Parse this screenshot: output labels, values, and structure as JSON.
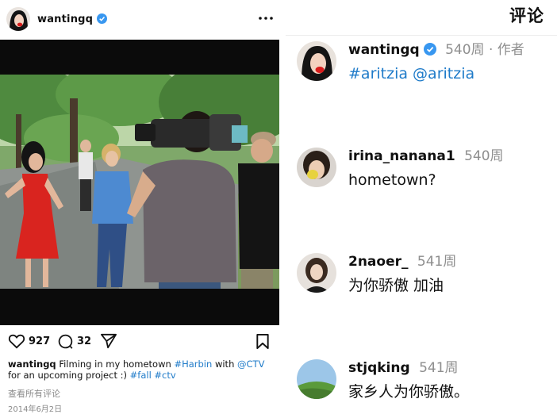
{
  "post": {
    "username": "wantingq",
    "likes": "927",
    "comments_count": "32",
    "caption": {
      "user": "wantingq",
      "text_1": "Filming in my hometown",
      "tag_1": "#Harbin",
      "text_2": "with",
      "tag_2": "@CTV",
      "text_3": "for an upcoming project :)",
      "tag_3": "#fall",
      "tag_4": "#ctv"
    },
    "view_all": "查看所有评论",
    "date": "2014年6月2日"
  },
  "comments_panel": {
    "title": "评论",
    "items": [
      {
        "user": "wantingq",
        "verified": true,
        "time": "540周",
        "author_label": "· 作者",
        "tags": [
          "#aritzia",
          "@aritzia"
        ],
        "text": ""
      },
      {
        "user": "irina_nanana1",
        "verified": false,
        "time": "540周",
        "text": "hometown?"
      },
      {
        "user": "2naoer_",
        "verified": false,
        "time": "541周",
        "text": "为你骄傲 加油"
      },
      {
        "user": "stjqking",
        "verified": false,
        "time": "541周",
        "text": "家乡人为你骄傲。"
      }
    ]
  },
  "colors": {
    "link": "#1f7bc9",
    "verified": "#3897f0",
    "muted": "#8e8e8e",
    "dress": "#d9241f"
  },
  "icons": [
    "verified-badge-icon",
    "more-options-icon",
    "heart-icon",
    "comment-icon",
    "share-icon",
    "bookmark-icon"
  ]
}
